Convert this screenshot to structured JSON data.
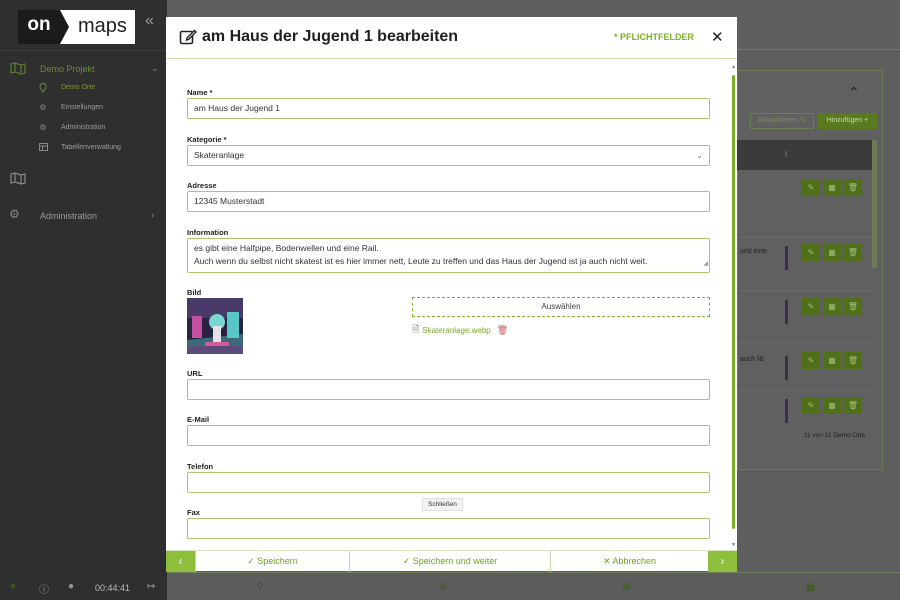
{
  "app": {
    "logo_left": "on",
    "logo_right": "maps",
    "collapse_icon": "«"
  },
  "sidebar": {
    "project_label": "Demo Projekt",
    "sub_items": [
      {
        "label": "Demo Orte",
        "icon": "pin-icon"
      },
      {
        "label": "Einstellungen",
        "icon": "gear-icon"
      },
      {
        "label": "Administration",
        "icon": "gears-icon"
      },
      {
        "label": "Tabellenverwaltung",
        "icon": "table-icon"
      }
    ],
    "admin_label": "Administration"
  },
  "background": {
    "refresh_label": "Aktualisieren",
    "add_label": "Hinzufügen",
    "header_col": "I",
    "row_texts": [
      "und eine",
      "auch f&"
    ],
    "count_text": "11 von 11 Demo Orte"
  },
  "bottombar": {
    "time": "00:44:41"
  },
  "modal": {
    "title": "am Haus der Jugend 1 bearbeiten",
    "required_note": "* PFLICHTFELDER",
    "fields": {
      "name_label": "Name *",
      "name_value": "am Haus der Jugend 1",
      "category_label": "Kategorie *",
      "category_value": "Skateranlage",
      "address_label": "Adresse",
      "address_value": "12345 Musterstadt",
      "info_label": "Information",
      "info_line1": "es gibt eine Halfpipe, Bodenwellen und eine Rail.",
      "info_line2": "Auch wenn du selbst nicht skatest ist es hier immer nett, Leute zu treffen und das Haus der Jugend ist ja auch nicht weit.",
      "image_label": "Bild",
      "choose_label": "Auswählen",
      "file_name": "Skateranlage.webp",
      "url_label": "URL",
      "url_value": "",
      "email_label": "E-Mail",
      "email_value": "",
      "phone_label": "Telefon",
      "phone_value": "",
      "fax_label": "Fax",
      "fax_value": ""
    },
    "tooltip": "Schließen",
    "footer": {
      "save": "Speichern",
      "save_continue": "Speichern und weiter",
      "cancel": "Abbrechen"
    }
  },
  "colors": {
    "accent": "#8dbf3c",
    "accent_text": "#7eb12c",
    "sidebar_bg": "#2f2f2f"
  }
}
